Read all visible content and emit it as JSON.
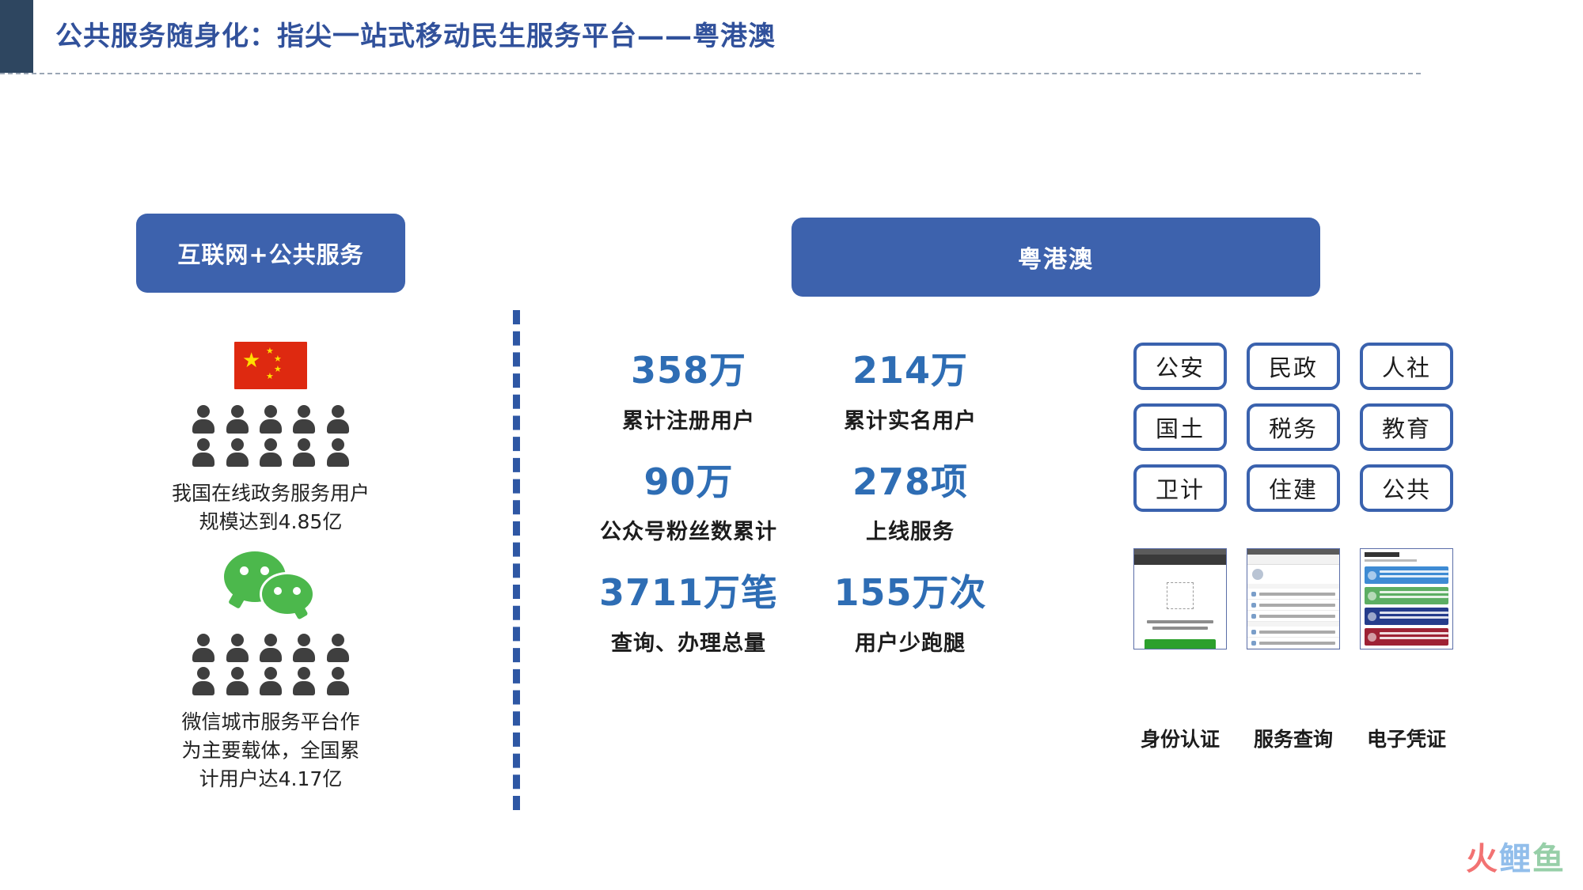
{
  "header": {
    "title": "公共服务随身化：指尖一站式移动民生服务平台——粤港澳"
  },
  "left_panel": {
    "pill_label": "互联网+公共服务",
    "flag_icon": "china-flag-icon",
    "caption_1": "我国在线政务服务用户",
    "caption_1b": "规模达到4.85亿",
    "wechat_icon": "wechat-icon",
    "caption_2": "微信城市服务平台作",
    "caption_2b": "为主要载体，全国累",
    "caption_2c": "计用户达4.17亿"
  },
  "right_panel": {
    "pill_label": "粤港澳",
    "stats": [
      {
        "value": "358万",
        "label": "累计注册用户"
      },
      {
        "value": "214万",
        "label": "累计实名用户"
      },
      {
        "value": "90万",
        "label": "公众号粉丝数累计"
      },
      {
        "value": "278项",
        "label": "上线服务"
      },
      {
        "value": "3711万笔",
        "label": "查询、办理总量"
      },
      {
        "value": "155万次",
        "label": "用户少跑腿"
      }
    ],
    "departments": [
      "公安",
      "民政",
      "人社",
      "国土",
      "税务",
      "教育",
      "卫计",
      "住建",
      "公共"
    ],
    "screenshots": [
      {
        "caption": "身份认证"
      },
      {
        "caption": "服务查询"
      },
      {
        "caption": "电子凭证"
      }
    ]
  },
  "watermark": {
    "part1": "火",
    "part2": "鲤",
    "part3": "鱼"
  },
  "colors": {
    "header_bar": "#2E4660",
    "title": "#31519B",
    "pill": "#3D62AD",
    "stat_value": "#2E6DB4",
    "tag_border": "#3A62AE",
    "divider": "#2E57A4",
    "flag_red": "#DE2910",
    "wechat_green": "#4CB84C"
  }
}
